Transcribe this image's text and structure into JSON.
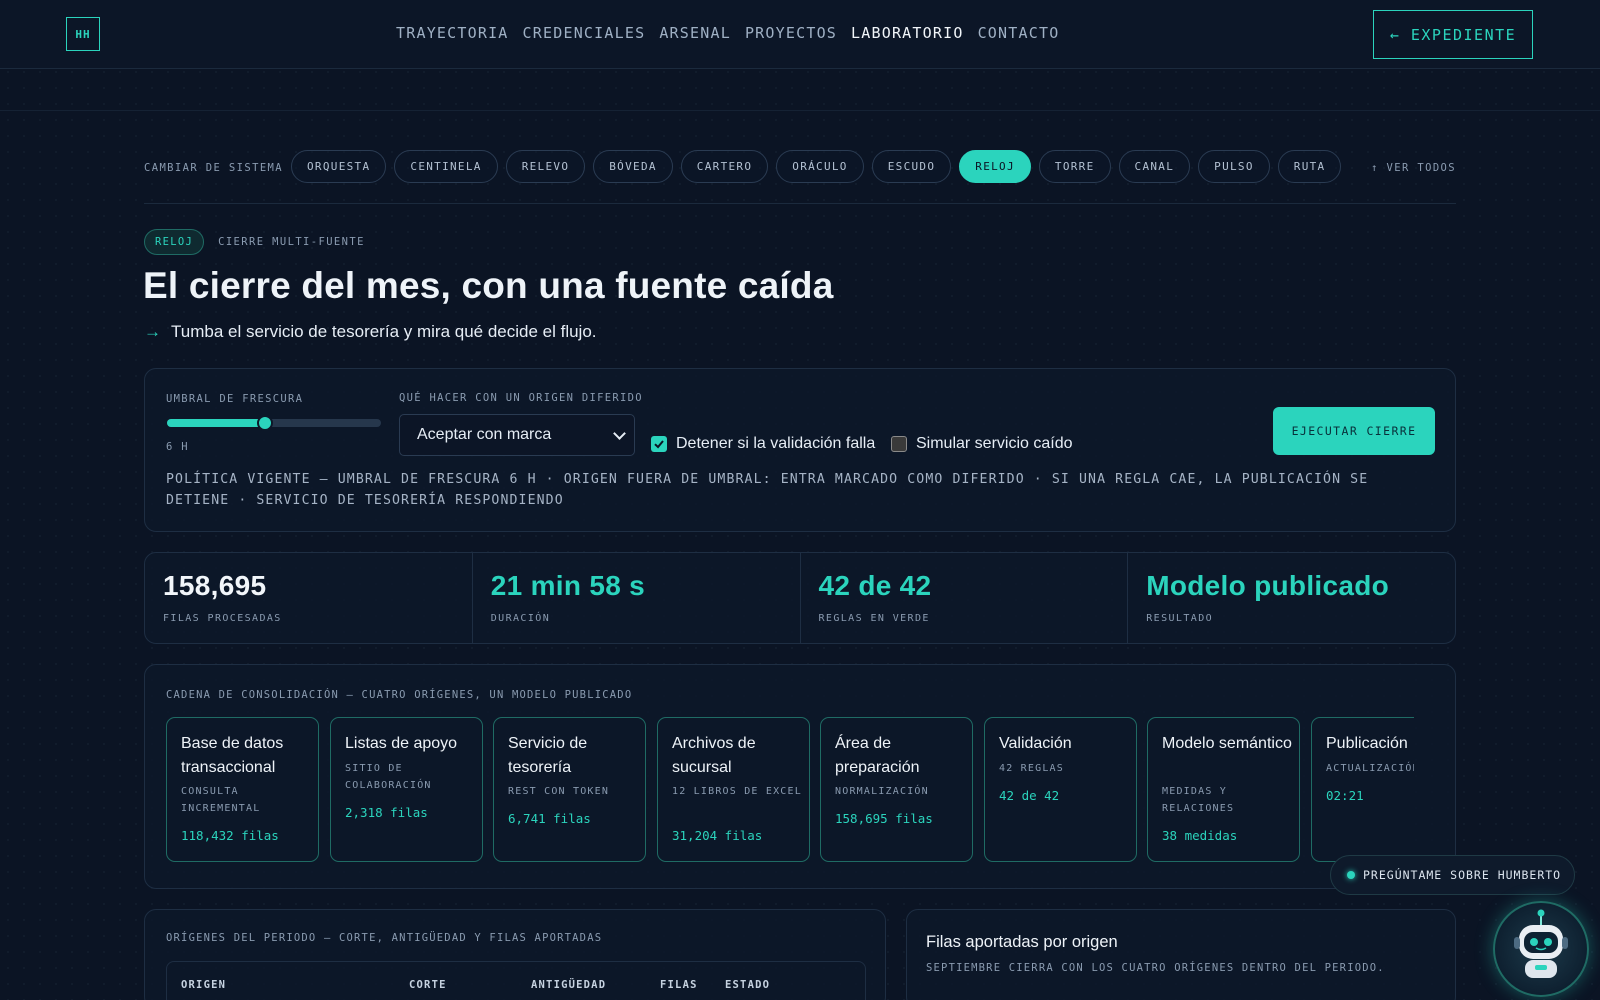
{
  "nav": {
    "logo": "HH",
    "links": [
      "TRAYECTORIA",
      "CREDENCIALES",
      "ARSENAL",
      "PROYECTOS",
      "LABORATORIO",
      "CONTACTO"
    ],
    "active_link": "LABORATORIO",
    "expediente_button": "← EXPEDIENTE"
  },
  "switcher": {
    "label": "CAMBIAR DE SISTEMA",
    "systems": [
      "ORQUESTA",
      "CENTINELA",
      "RELEVO",
      "BÓVEDA",
      "CARTERO",
      "ORÁCULO",
      "ESCUDO",
      "RELOJ",
      "TORRE",
      "CANAL",
      "PULSO",
      "RUTA"
    ],
    "active": "RELOJ",
    "view_all": "↑ VER TODOS"
  },
  "hero": {
    "badge": "RELOJ",
    "badge_subtitle": "CIERRE MULTI-FUENTE",
    "title": "El cierre del mes, con una fuente caída",
    "arrow": "→",
    "subtitle": "Tumba el servicio de tesorería y mira qué decide el flujo."
  },
  "controls": {
    "freshness_label": "UMBRAL DE FRESCURA",
    "freshness_value_text": "6 H",
    "freshness_fraction": 0.46,
    "deferred_label": "QUÉ HACER CON UN ORIGEN DIFERIDO",
    "deferred_selected": "Aceptar con marca",
    "stop_on_fail_label": "Detener si la validación falla",
    "stop_on_fail_checked": true,
    "simulate_down_label": "Simular servicio caído",
    "simulate_down_checked": false,
    "run_button": "EJECUTAR CIERRE",
    "policy_text": "POLÍTICA VIGENTE — UMBRAL DE FRESCURA 6 H · ORIGEN FUERA DE UMBRAL: ENTRA MARCADO COMO DIFERIDO · SI UNA REGLA CAE, LA PUBLICACIÓN SE DETIENE · SERVICIO DE TESORERÍA RESPONDIENDO"
  },
  "stats": [
    {
      "value": "158,695",
      "label": "FILAS PROCESADAS",
      "accent": false
    },
    {
      "value": "21 min 58 s",
      "label": "DURACIÓN",
      "accent": true
    },
    {
      "value": "42 de 42",
      "label": "REGLAS EN VERDE",
      "accent": true
    },
    {
      "value": "Modelo publicado",
      "label": "RESULTADO",
      "accent": true
    }
  ],
  "chain": {
    "title": "CADENA DE CONSOLIDACIÓN — CUATRO ORÍGENES, UN MODELO PUBLICADO",
    "steps": [
      {
        "title": "Base de datos transaccional",
        "sub": "CONSULTA INCREMENTAL",
        "value": "118,432 filas"
      },
      {
        "title": "Listas de apoyo",
        "sub": "SITIO DE COLABORACIÓN",
        "value": "2,318 filas"
      },
      {
        "title": "Servicio de tesorería",
        "sub": "REST CON TOKEN",
        "value": "6,741 filas"
      },
      {
        "title": "Archivos de sucursal",
        "sub": "12 LIBROS DE EXCEL",
        "value": "31,204 filas"
      },
      {
        "title": "Área de preparación",
        "sub": "NORMALIZACIÓN",
        "value": "158,695 filas"
      },
      {
        "title": "Validación",
        "sub": "42 REGLAS",
        "value": "42 de 42"
      },
      {
        "title": "Modelo semántico",
        "sub": "MEDIDAS Y RELACIONES",
        "value": "38 medidas"
      },
      {
        "title": "Publicación",
        "sub": "ACTUALIZACIÓN",
        "value": "02:21"
      }
    ]
  },
  "sources_panel": {
    "title": "ORÍGENES DEL PERIODO — CORTE, ANTIGÜEDAD Y FILAS APORTADAS",
    "columns": [
      "ORIGEN",
      "CORTE",
      "ANTIGÜEDAD",
      "FILAS",
      "ESTADO"
    ]
  },
  "rows_panel": {
    "title": "Filas aportadas por origen",
    "subtitle": "SEPTIEMBRE CIERRA CON LOS CUATRO ORÍGENES DENTRO DEL PERIODO."
  },
  "assistant": {
    "label": "PREGÚNTAME SOBRE HUMBERTO"
  },
  "colors": {
    "accent": "#2bd4bd",
    "background": "#0b1424",
    "panel": "#0d1829"
  },
  "icons": [
    "arrow-left-icon",
    "arrow-up-icon",
    "arrow-right-icon",
    "chevron-down-icon",
    "checkbox-check-icon",
    "robot-avatar-icon"
  ]
}
